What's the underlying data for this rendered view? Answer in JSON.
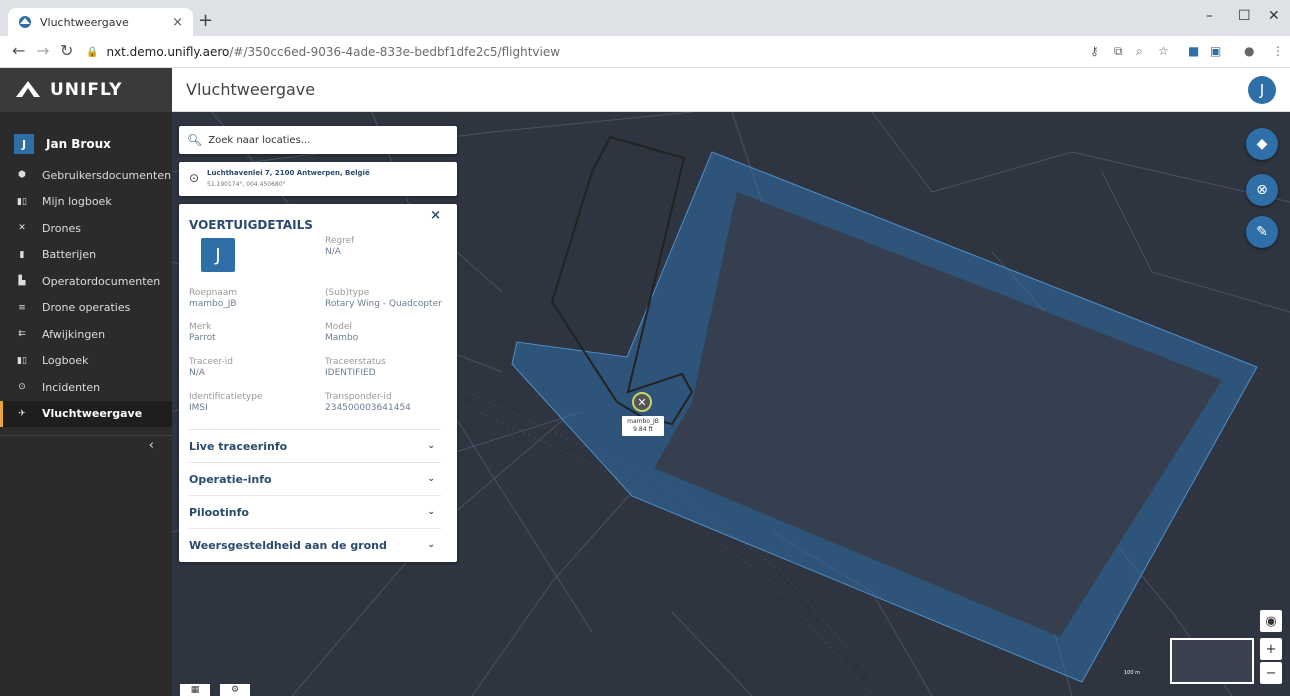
{
  "browser": {
    "tab_title": "Vluchtweergave",
    "tab_close": "×",
    "new_tab": "+",
    "url_host": "nxt.demo.unifly.aero",
    "url_path": "/#/350cc6ed-9036-4ade-833e-bedbf1dfe2c5/flightview"
  },
  "app": {
    "logo": "UNIFLY",
    "page_title": "Vluchtweergave",
    "user_initial": "J"
  },
  "sidebar": {
    "user_initial": "J",
    "user_name": "Jan Broux",
    "items": [
      {
        "label": "Gebruikersdocumenten",
        "icon": "shield-icon"
      },
      {
        "label": "Mijn logboek",
        "icon": "book-icon"
      },
      {
        "label": "Drones",
        "icon": "drone-icon"
      },
      {
        "label": "Batterijen",
        "icon": "battery-icon"
      },
      {
        "label": "Operatordocumenten",
        "icon": "document-icon"
      },
      {
        "label": "Drone operaties",
        "icon": "list-icon"
      },
      {
        "label": "Afwijkingen",
        "icon": "deviation-icon"
      },
      {
        "label": "Logboek",
        "icon": "book-icon"
      },
      {
        "label": "Incidenten",
        "icon": "alert-icon"
      },
      {
        "label": "Vluchtweergave",
        "icon": "airplane-icon",
        "active": true
      }
    ],
    "collapse": "‹"
  },
  "search": {
    "placeholder": "Zoek naar locaties..."
  },
  "address": {
    "line1": "Luchthavenlei 7, 2100 Antwerpen, België",
    "line2": "51.190174°, 004.450680°"
  },
  "details": {
    "title": "VOERTUIGDETAILS",
    "close": "×",
    "avatar": "J",
    "fields": {
      "regref": {
        "label": "Regref",
        "value": "N/A"
      },
      "roepnaam": {
        "label": "Roepnaam",
        "value": "mambo_JB"
      },
      "subtype": {
        "label": "(Sub)type",
        "value": "Rotary Wing - Quadcopter"
      },
      "merk": {
        "label": "Merk",
        "value": "Parrot"
      },
      "model": {
        "label": "Model",
        "value": "Mambo"
      },
      "traceer_id": {
        "label": "Traceer-id",
        "value": "N/A"
      },
      "traceerstatus": {
        "label": "Traceerstatus",
        "value": "IDENTIFIED"
      },
      "identificatietype": {
        "label": "Identificatietype",
        "value": "IMSI"
      },
      "transponder_id": {
        "label": "Transponder-id",
        "value": "234500003641454"
      }
    },
    "sections": [
      {
        "label": "Live traceerinfo"
      },
      {
        "label": "Operatie-info"
      },
      {
        "label": "Pilootinfo"
      },
      {
        "label": "Weersgesteldheid aan de grond"
      }
    ]
  },
  "map": {
    "drone_name": "mambo_JB",
    "drone_altitude": "9.84 ft",
    "scale_label": "100 m",
    "zoom_in": "+",
    "zoom_out": "−",
    "colors": {
      "background": "#2e3440",
      "zone_fill": "#2f6fa7",
      "accent": "#2f6fa7"
    }
  }
}
